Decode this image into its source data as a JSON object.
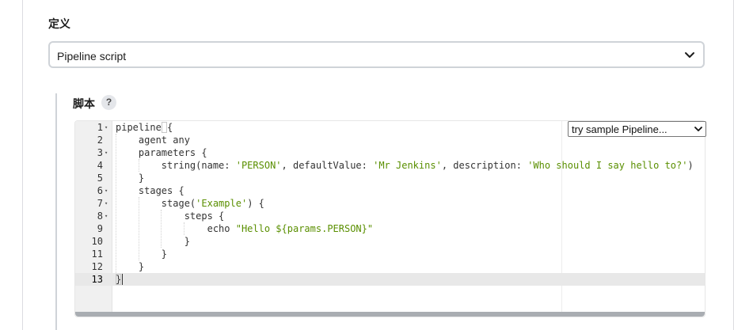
{
  "definition": {
    "label": "定义",
    "selected": "Pipeline script"
  },
  "script": {
    "label": "脚本",
    "help": "?"
  },
  "editor": {
    "sample_select": "try sample Pipeline...",
    "active_line": 13,
    "lines": [
      {
        "num": "1",
        "fold": true,
        "parts": [
          {
            "t": "pipeline {",
            "c": ""
          }
        ]
      },
      {
        "num": "2",
        "fold": false,
        "parts": [
          {
            "t": "    agent any",
            "c": ""
          }
        ]
      },
      {
        "num": "3",
        "fold": true,
        "parts": [
          {
            "t": "    parameters {",
            "c": ""
          }
        ]
      },
      {
        "num": "4",
        "fold": false,
        "parts": [
          {
            "t": "        string(name: ",
            "c": ""
          },
          {
            "t": "'PERSON'",
            "c": "str"
          },
          {
            "t": ", defaultValue: ",
            "c": ""
          },
          {
            "t": "'Mr Jenkins'",
            "c": "str"
          },
          {
            "t": ", description: ",
            "c": ""
          },
          {
            "t": "'Who should I say hello to?'",
            "c": "str"
          },
          {
            "t": ")",
            "c": ""
          }
        ]
      },
      {
        "num": "5",
        "fold": false,
        "parts": [
          {
            "t": "    }",
            "c": ""
          }
        ]
      },
      {
        "num": "6",
        "fold": true,
        "parts": [
          {
            "t": "    stages {",
            "c": ""
          }
        ]
      },
      {
        "num": "7",
        "fold": true,
        "parts": [
          {
            "t": "        stage(",
            "c": ""
          },
          {
            "t": "'Example'",
            "c": "str"
          },
          {
            "t": ") {",
            "c": ""
          }
        ]
      },
      {
        "num": "8",
        "fold": true,
        "parts": [
          {
            "t": "            steps {",
            "c": ""
          }
        ]
      },
      {
        "num": "9",
        "fold": false,
        "parts": [
          {
            "t": "                echo ",
            "c": ""
          },
          {
            "t": "\"Hello ${params.PERSON}\"",
            "c": "str"
          }
        ]
      },
      {
        "num": "10",
        "fold": false,
        "parts": [
          {
            "t": "            }",
            "c": ""
          }
        ]
      },
      {
        "num": "11",
        "fold": false,
        "parts": [
          {
            "t": "        }",
            "c": ""
          }
        ]
      },
      {
        "num": "12",
        "fold": false,
        "parts": [
          {
            "t": "    }",
            "c": ""
          }
        ]
      },
      {
        "num": "13",
        "fold": false,
        "parts": [
          {
            "t": "}",
            "c": ""
          }
        ]
      }
    ]
  },
  "icons": {
    "select_chevron": "chevron-down-icon",
    "fold_marker": "fold-arrow-icon"
  },
  "colors": {
    "string": "#5a8f00",
    "active_line": "#e8e8e8",
    "gutter": "#f0f0f0"
  }
}
